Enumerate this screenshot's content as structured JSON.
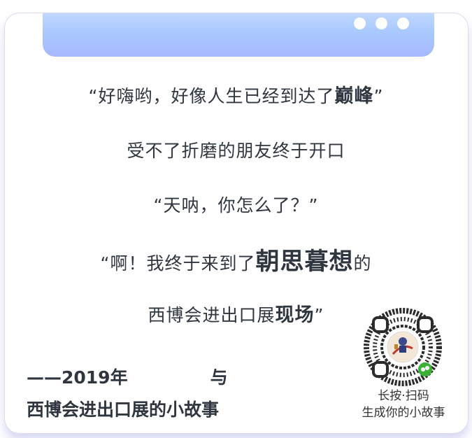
{
  "lines": {
    "l1_pre": "“好嗨哟，好像人生已经到达了",
    "l1_bold": "巅峰",
    "l1_post": "”",
    "l2": "受不了折磨的朋友终于开口",
    "l3": "“天呐，你怎么了？”",
    "l4_pre": "“啊！我终于来到了",
    "l4_bold": "朝思暮想",
    "l4_post": "的",
    "l5_pre": "西博会进出口展",
    "l5_bold": "现场",
    "l5_post": "”"
  },
  "credit": {
    "line1_a": "——2019年",
    "line1_b": "与",
    "line2": "西博会进出口展的小故事"
  },
  "qr": {
    "caption1": "长按·扫码",
    "caption2": "生成你的小故事"
  },
  "colors": {
    "header_light": "#cfe2ff",
    "header_dark": "#a6b8ff",
    "text": "#2f3640",
    "shadow": "#8c8cdc"
  }
}
